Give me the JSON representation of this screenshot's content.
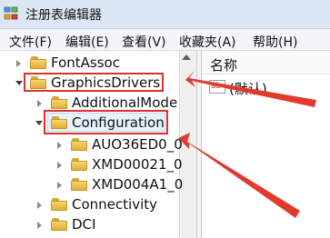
{
  "window": {
    "title": "注册表编辑器"
  },
  "menu": {
    "items": [
      "文件(F)",
      "编辑(E)",
      "查看(V)",
      "收藏夹(A)",
      "帮助(H)"
    ]
  },
  "tree": {
    "items": [
      {
        "label": "FontAssoc",
        "expandable": true,
        "expanded": false
      },
      {
        "label": "GraphicsDrivers",
        "expandable": true,
        "expanded": true,
        "highlighted": true
      },
      {
        "label": "AdditionalMode",
        "expandable": true,
        "expanded": false
      },
      {
        "label": "Configuration",
        "expandable": true,
        "expanded": true,
        "selected": true
      },
      {
        "label": "AUO36ED0_0",
        "expandable": true,
        "expanded": false
      },
      {
        "label": "XMD00021_0",
        "expandable": true,
        "expanded": false
      },
      {
        "label": "XMD004A1_0",
        "expandable": true,
        "expanded": false
      },
      {
        "label": "Connectivity",
        "expandable": true,
        "expanded": false
      },
      {
        "label": "DCI",
        "expandable": true,
        "expanded": false
      }
    ]
  },
  "values_pane": {
    "column_name": "名称",
    "rows": [
      {
        "icon": "ab-string-icon",
        "icon_text": "ab",
        "name": "(默认)"
      }
    ]
  },
  "colors": {
    "annotation_red": "#d9312e",
    "folder_yellow": "#f0c34e",
    "selection_blue": "#e7f2fd"
  }
}
